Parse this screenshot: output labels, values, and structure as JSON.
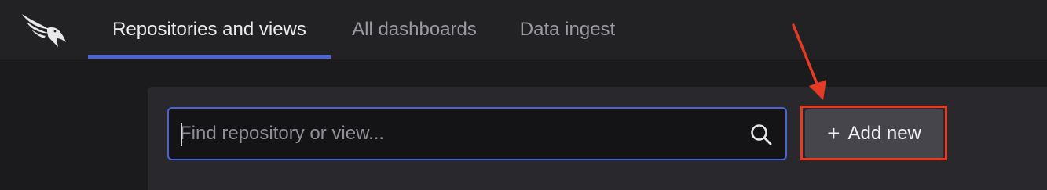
{
  "nav": {
    "logo_icon": "falcon-logo-icon",
    "tabs": [
      {
        "label": "Repositories and views",
        "active": true
      },
      {
        "label": "All dashboards",
        "active": false
      },
      {
        "label": "Data ingest",
        "active": false
      }
    ]
  },
  "search": {
    "placeholder": "Find repository or view...",
    "value": "",
    "icon": "search-icon"
  },
  "actions": {
    "add_icon": "plus-icon",
    "add_label": "Add new"
  },
  "annotation": {
    "color": "#e53a24",
    "target": "add-new-button"
  },
  "colors": {
    "accent": "#4a63d8",
    "topbar": "#222224",
    "panel": "#29292d",
    "button": "#45454b"
  }
}
